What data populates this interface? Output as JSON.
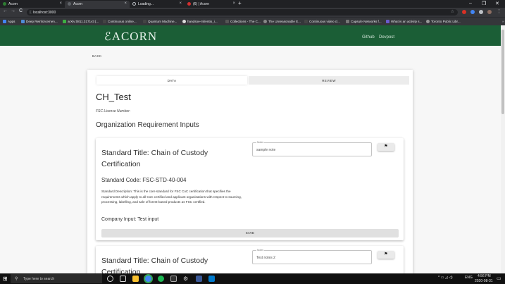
{
  "browser": {
    "tabs": [
      {
        "label": "Acorn",
        "active": false
      },
      {
        "label": "Acorn",
        "active": true
      },
      {
        "label": "Loading...",
        "active": false
      },
      {
        "label": "(6) | Acorn",
        "active": false
      }
    ],
    "new_tab": "+",
    "window": {
      "minimize": "–",
      "maximize": "❐",
      "close": "✕"
    },
    "nav": {
      "back": "←",
      "forward": "→",
      "reload": "C"
    },
    "url": "localhost:3000",
    "bookmarks": [
      {
        "label": "Apps",
        "color": "#4285f4"
      },
      {
        "label": "Deep Reinforcemen...",
        "color": "#4f8cd6"
      },
      {
        "label": "arXiv:0811.3171v3 [...",
        "color": "#3cb043"
      },
      {
        "label": "Continuous online...",
        "color": "#444"
      },
      {
        "label": "Quantum Machine...",
        "color": "#444"
      },
      {
        "label": "handsoe-ml/entio_i...",
        "color": "#ddd"
      },
      {
        "label": "Collections - The C...",
        "color": "#555"
      },
      {
        "label": "The Unreasonable E...",
        "color": "#888"
      },
      {
        "label": "Continuous video cl...",
        "color": "#444"
      },
      {
        "label": "Capsule Networks f...",
        "color": "#777"
      },
      {
        "label": "What is an activity s...",
        "color": "#6a5acd"
      },
      {
        "label": "Toronto Public Libr...",
        "color": "#999"
      }
    ]
  },
  "header": {
    "logo": "ACORN",
    "links": [
      "Github",
      "Devpost"
    ],
    "brand_color": "#1b5e36"
  },
  "page": {
    "back": "BACK",
    "tabs": [
      "DATA",
      "REVIEW"
    ],
    "title": "CH_Test",
    "license": "FSC License Number:",
    "section_heading": "Organization Requirement Inputs",
    "standards": [
      {
        "title": "Standard Title: Chain of Custody Certification",
        "code": "Standard Code: FSC-STD-40-004",
        "description": "Standard Description: This is the core standard for FSC CoC certification that specifies the requirements which apply to all CoC certified and applicant organizations with respect to sourcing, processing, labelling, and sale of forest-based products as FSC certified.",
        "input": "Company Input: Test input",
        "notes_label": "Notes",
        "notes_value": "sample note",
        "flag_icon": "flag-icon",
        "save": "SAVE"
      },
      {
        "title": "Standard Title: Chain of Custody Certification",
        "notes_label": "Notes",
        "notes_value": "Test notes 2",
        "flag_icon": "flag-icon"
      }
    ]
  },
  "taskbar": {
    "search_placeholder": "Type here to search",
    "time": "4:56 PM",
    "date": "2020-08-31",
    "language": "ENG"
  }
}
